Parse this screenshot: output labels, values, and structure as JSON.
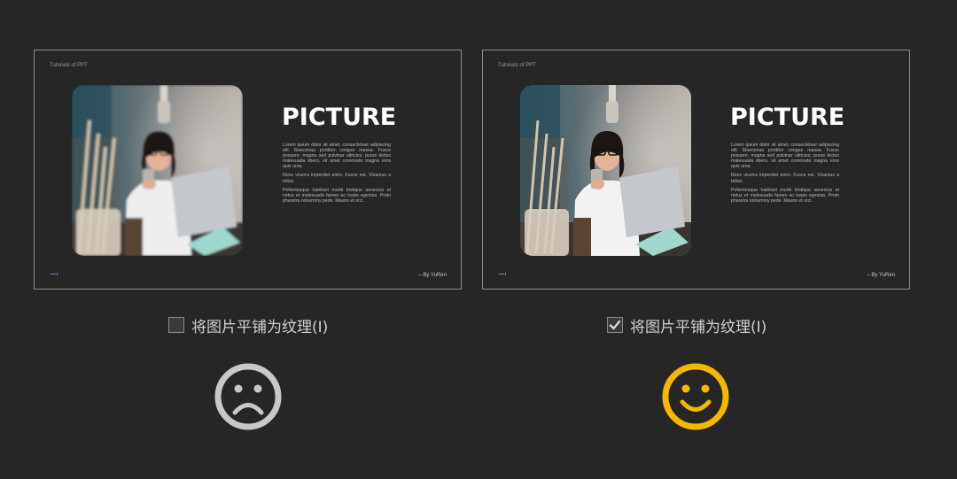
{
  "slides": [
    {
      "header": "Tutorials of PPT",
      "title": "PICTURE",
      "paragraphs": [
        "Lorem ipsum dolor sit amet, consectetuer adipiscing elit. Maecenas porttitor congue massa. Fusce posuere, magna sed pulvinar ultricies, purus lectus malesuada libero, sit amet commodo magna eros quis urna.",
        "Nunc viverra imperdiet enim. Fusce est. Vivamus a tellus.",
        "Pellentesque habitant morbi tristique senectus et netus et malesuada fames ac turpis egestas. Proin pharetra nonummy pede. Mauris et orci."
      ],
      "footer": "– By YuRen"
    },
    {
      "header": "Tutorials of PPT",
      "title": "PICTURE",
      "paragraphs": [
        "Lorem ipsum dolor sit amet, consectetuer adipiscing elit. Maecenas porttitor congue massa. Fusce posuere, magna sed pulvinar ultricies, purus lectus malesuada libero, sit amet commodo magna eros quis urna.",
        "Nunc viverra imperdiet enim. Fusce est. Vivamus a tellus.",
        "Pellentesque habitant morbi tristique senectus et netus et malesuada fames ac turpis egestas. Proin pharetra nonummy pede. Mauris et orci."
      ],
      "footer": "– By YuRen"
    }
  ],
  "options": [
    {
      "label": "将图片平铺为纹理(I)",
      "checked": false
    },
    {
      "label": "将图片平铺为纹理(I)",
      "checked": true
    }
  ],
  "faces": [
    {
      "icon": "sad-face-icon",
      "color": "#c8c8c8"
    },
    {
      "icon": "happy-face-icon",
      "color": "#f5b800"
    }
  ],
  "colors": {
    "background": "#262626",
    "slide_border": "#8c8c8c",
    "accent": "#f5b800"
  }
}
